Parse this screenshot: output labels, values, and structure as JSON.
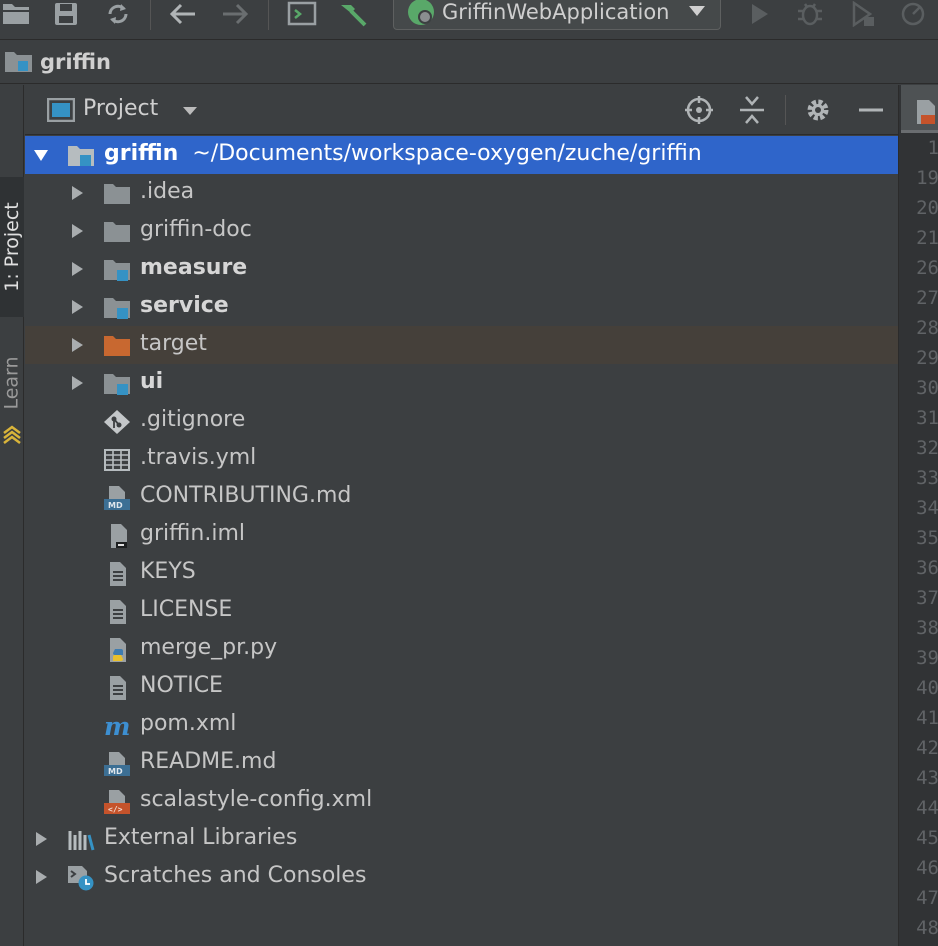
{
  "toolbar": {
    "run_config_label": "GriffinWebApplication",
    "icons": [
      "open-icon",
      "save-icon",
      "sync-icon",
      "back-icon",
      "forward-icon",
      "terminal-icon",
      "build-hammer-icon",
      "run-icon",
      "debug-icon",
      "coverage-icon",
      "profile-icon"
    ]
  },
  "breadcrumb": {
    "label": "griffin"
  },
  "side_stripe": {
    "project_tab": "1: Project",
    "learn_tab": "Learn"
  },
  "panel": {
    "title": "Project"
  },
  "tree": {
    "root": {
      "name": "griffin",
      "path": "~/Documents/workspace-oxygen/zuche/griffin"
    },
    "items": [
      {
        "label": ".idea",
        "icon": "folder-icon"
      },
      {
        "label": "griffin-doc",
        "icon": "folder-icon"
      },
      {
        "label": "measure",
        "icon": "module-folder-icon"
      },
      {
        "label": "service",
        "icon": "module-folder-icon"
      },
      {
        "label": "target",
        "icon": "excluded-folder-icon"
      },
      {
        "label": "ui",
        "icon": "module-folder-icon"
      },
      {
        "label": ".gitignore",
        "icon": "git-file-icon"
      },
      {
        "label": ".travis.yml",
        "icon": "yaml-file-icon"
      },
      {
        "label": "CONTRIBUTING.md",
        "icon": "markdown-file-icon"
      },
      {
        "label": "griffin.iml",
        "icon": "iml-file-icon"
      },
      {
        "label": "KEYS",
        "icon": "text-file-icon"
      },
      {
        "label": "LICENSE",
        "icon": "text-file-icon"
      },
      {
        "label": "merge_pr.py",
        "icon": "python-file-icon"
      },
      {
        "label": "NOTICE",
        "icon": "text-file-icon"
      },
      {
        "label": "pom.xml",
        "icon": "maven-icon"
      },
      {
        "label": "README.md",
        "icon": "markdown-file-icon"
      },
      {
        "label": "scalastyle-config.xml",
        "icon": "xml-file-icon"
      }
    ],
    "external_libraries": "External Libraries",
    "scratches": "Scratches and Consoles"
  },
  "gutter": {
    "line_numbers": [
      "1",
      "19",
      "20",
      "21",
      "26",
      "27",
      "28",
      "29",
      "30",
      "31",
      "32",
      "33",
      "34",
      "35",
      "36",
      "37",
      "38",
      "39",
      "40",
      "41",
      "42",
      "43",
      "44",
      "45",
      "46",
      "47",
      "48"
    ]
  },
  "colors": {
    "selection": "#2f65ca",
    "excluded_row": "#45403a",
    "folder": "#8b9194",
    "module_badge": "#3592c4",
    "excluded_folder": "#c86830",
    "background": "#3c3f41"
  }
}
